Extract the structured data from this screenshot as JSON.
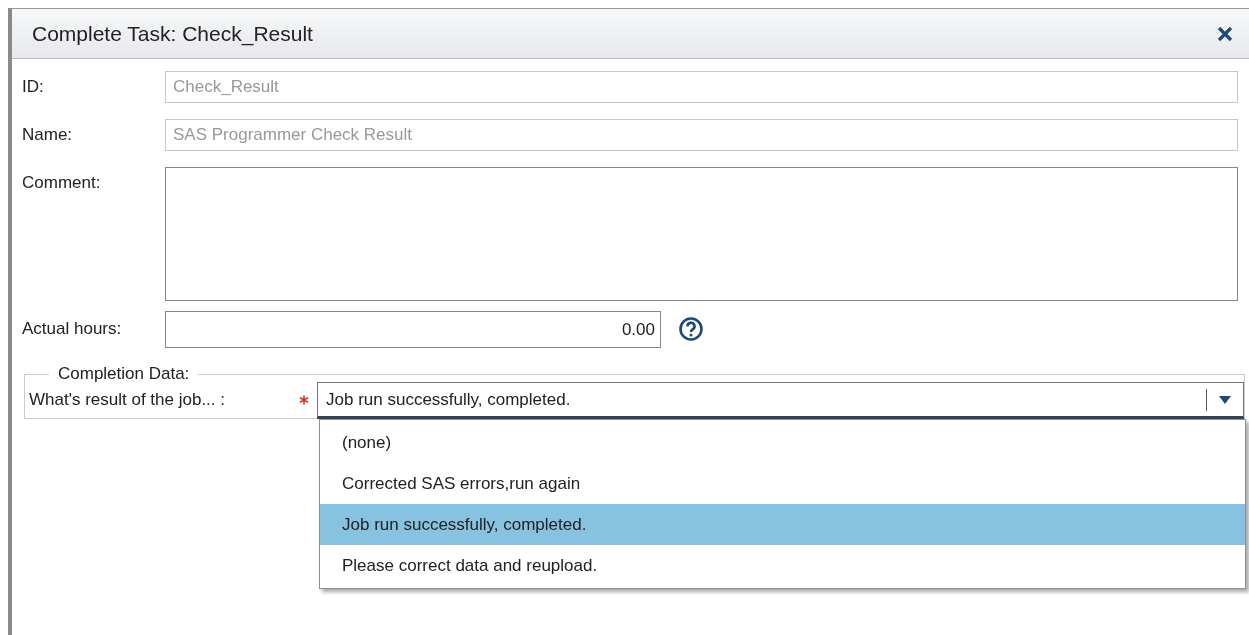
{
  "window": {
    "title": "Complete Task: Check_Result"
  },
  "fields": [
    {
      "label": "ID:",
      "kind": "text",
      "value": "Check_Result",
      "disabled": true
    },
    {
      "label": "Name:",
      "kind": "text",
      "value": "SAS Programmer Check Result",
      "disabled": true
    },
    {
      "label": "Comment:",
      "kind": "textarea",
      "disabled": false
    },
    {
      "label": "Actual hours:",
      "kind": "number",
      "value": "0.00",
      "disabled": false
    }
  ],
  "completion_data": {
    "legend": "Completion Data:",
    "question": "What's result of the job... :",
    "required": true,
    "value": "Job run successfully, completed.",
    "expanded": true,
    "options": [
      {
        "label": "(none)",
        "selected": false
      },
      {
        "label": "Corrected SAS errors,run again",
        "selected": false
      },
      {
        "label": "Job run successfully, completed.",
        "selected": true
      },
      {
        "label": "Please correct data and reupload.",
        "selected": false
      }
    ]
  }
}
